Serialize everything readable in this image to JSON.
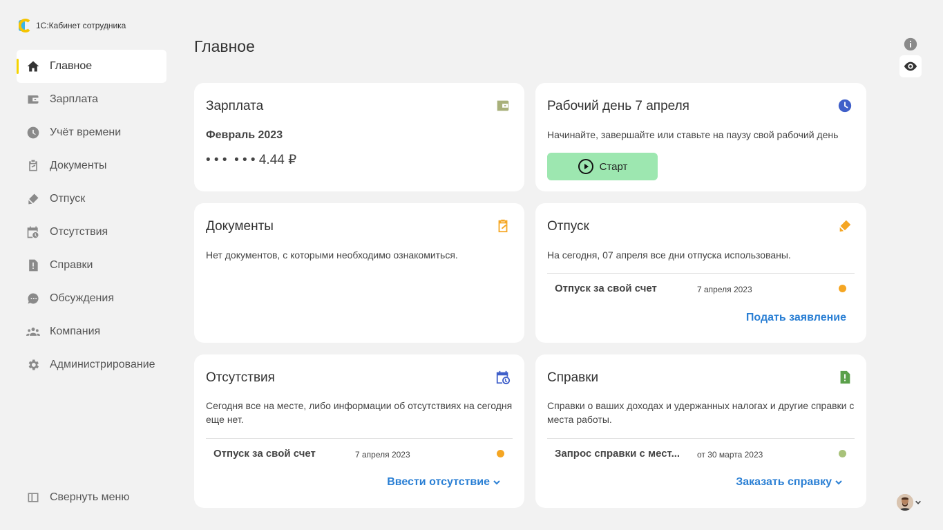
{
  "app": {
    "name": "1С:Кабинет сотрудника"
  },
  "colors": {
    "accent": "#f5d400",
    "link": "#2a7fd4",
    "start_button": "#9de7b0",
    "status_orange": "#f5a623",
    "status_green": "#a8c27a"
  },
  "sidebar": {
    "items": [
      {
        "label": "Главное",
        "icon": "home-icon",
        "active": true
      },
      {
        "label": "Зарплата",
        "icon": "wallet-icon"
      },
      {
        "label": "Учёт времени",
        "icon": "clock-icon"
      },
      {
        "label": "Документы",
        "icon": "clipboard-icon"
      },
      {
        "label": "Отпуск",
        "icon": "suitcase-icon"
      },
      {
        "label": "Отсутствия",
        "icon": "calendar-clock-icon"
      },
      {
        "label": "Справки",
        "icon": "doc-alert-icon"
      },
      {
        "label": "Обсуждения",
        "icon": "chat-icon"
      },
      {
        "label": "Компания",
        "icon": "people-icon"
      },
      {
        "label": "Администрирование",
        "icon": "gear-icon"
      }
    ],
    "collapse_label": "Свернуть меню"
  },
  "header": {
    "title": "Главное"
  },
  "cards": {
    "salary": {
      "title": "Зарплата",
      "period": "Февраль 2023",
      "amount": "• • •  • • • 4.44 ₽"
    },
    "workday": {
      "title": "Рабочий день 7 апреля",
      "text": "Начинайте, завершайте или ставьте на паузу свой рабочий день",
      "button": "Старт"
    },
    "documents": {
      "title": "Документы",
      "text": "Нет документов, с которыми необходимо ознакомиться."
    },
    "vacation": {
      "title": "Отпуск",
      "text": "На сегодня, 07 апреля все дни отпуска использованы.",
      "row_label": "Отпуск за свой счет",
      "row_date": "7 апреля 2023",
      "link": "Подать заявление"
    },
    "absences": {
      "title": "Отсутствия",
      "text": "Сегодня все на месте, либо информации об отсутствиях на сегодня еще нет.",
      "row_label": "Отпуск за свой счет",
      "row_date": "7 апреля 2023",
      "link": "Ввести отсутствие"
    },
    "certificates": {
      "title": "Справки",
      "text": "Справки о ваших доходах и удержанных налогах и другие справки с места работы.",
      "row_label": "Запрос справки с мест...",
      "row_date": "от 30 марта 2023",
      "link": "Заказать справку"
    }
  }
}
